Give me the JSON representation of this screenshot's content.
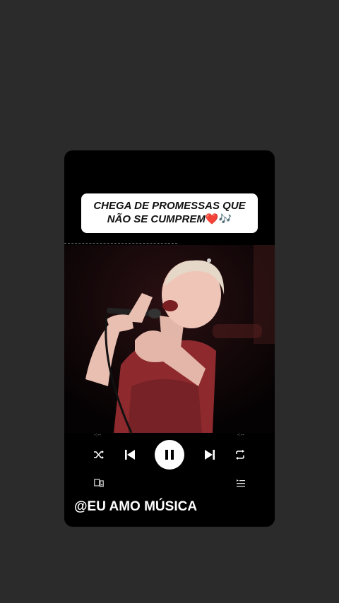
{
  "caption": {
    "line1": "CHEGA DE PROMESSAS QUE",
    "line2": "NÃO SE CUMPREM",
    "emoji": "❤️🎶"
  },
  "player": {
    "elapsed": "-:--",
    "remaining": "-:--",
    "state": "playing",
    "controls": [
      "shuffle-icon",
      "previous-icon",
      "pause-icon",
      "next-icon",
      "repeat-icon"
    ],
    "secondary": [
      "devices-icon",
      "queue-icon"
    ]
  },
  "handle": "@EU AMO MÚSICA",
  "colors": {
    "background": "#2b2b2b",
    "card": "#000000",
    "dress": "#8e2a2e",
    "accent": "#ffffff"
  }
}
